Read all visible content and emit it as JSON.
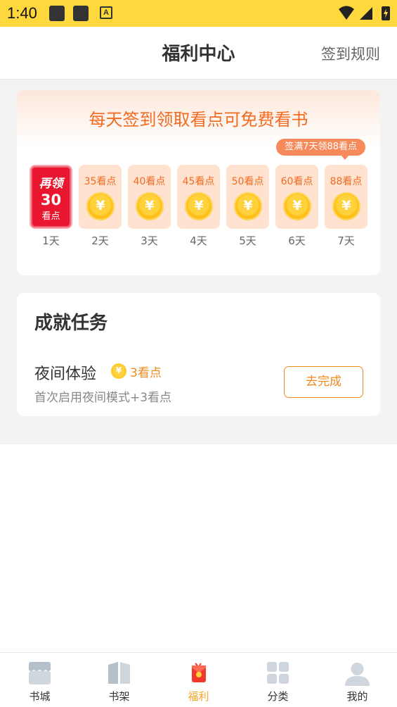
{
  "status_bar": {
    "time": "1:40",
    "a_icon": "A"
  },
  "header": {
    "title": "福利中心",
    "rules_link": "签到规则"
  },
  "sign_in": {
    "banner": "每天签到领取看点可免费看书",
    "tooltip": "签满7天领88看点",
    "claimed_day": {
      "top": "再领",
      "num": "30",
      "unit": "看点",
      "day": "1天"
    },
    "days": [
      {
        "amount": "35看点",
        "day": "2天"
      },
      {
        "amount": "40看点",
        "day": "3天"
      },
      {
        "amount": "45看点",
        "day": "4天"
      },
      {
        "amount": "50看点",
        "day": "5天"
      },
      {
        "amount": "60看点",
        "day": "6天"
      },
      {
        "amount": "88看点",
        "day": "7天"
      }
    ],
    "coin_symbol": "¥"
  },
  "tasks": {
    "section_title": "成就任务",
    "items": [
      {
        "name": "夜间体验",
        "reward": "3看点",
        "description": "首次启用夜间模式+3看点",
        "button": "去完成"
      }
    ]
  },
  "bottom_nav": {
    "items": [
      {
        "label": "书城",
        "icon": "store-icon",
        "active": false
      },
      {
        "label": "书架",
        "icon": "book-icon",
        "active": false
      },
      {
        "label": "福利",
        "icon": "red-envelope-icon",
        "active": true
      },
      {
        "label": "分类",
        "icon": "grid-icon",
        "active": false
      },
      {
        "label": "我的",
        "icon": "user-icon",
        "active": false
      }
    ]
  },
  "colors": {
    "status_bar": "#ffd83e",
    "accent_orange": "#f26b21",
    "active_tab": "#f5a623",
    "claimed_red": "#e8172f"
  }
}
